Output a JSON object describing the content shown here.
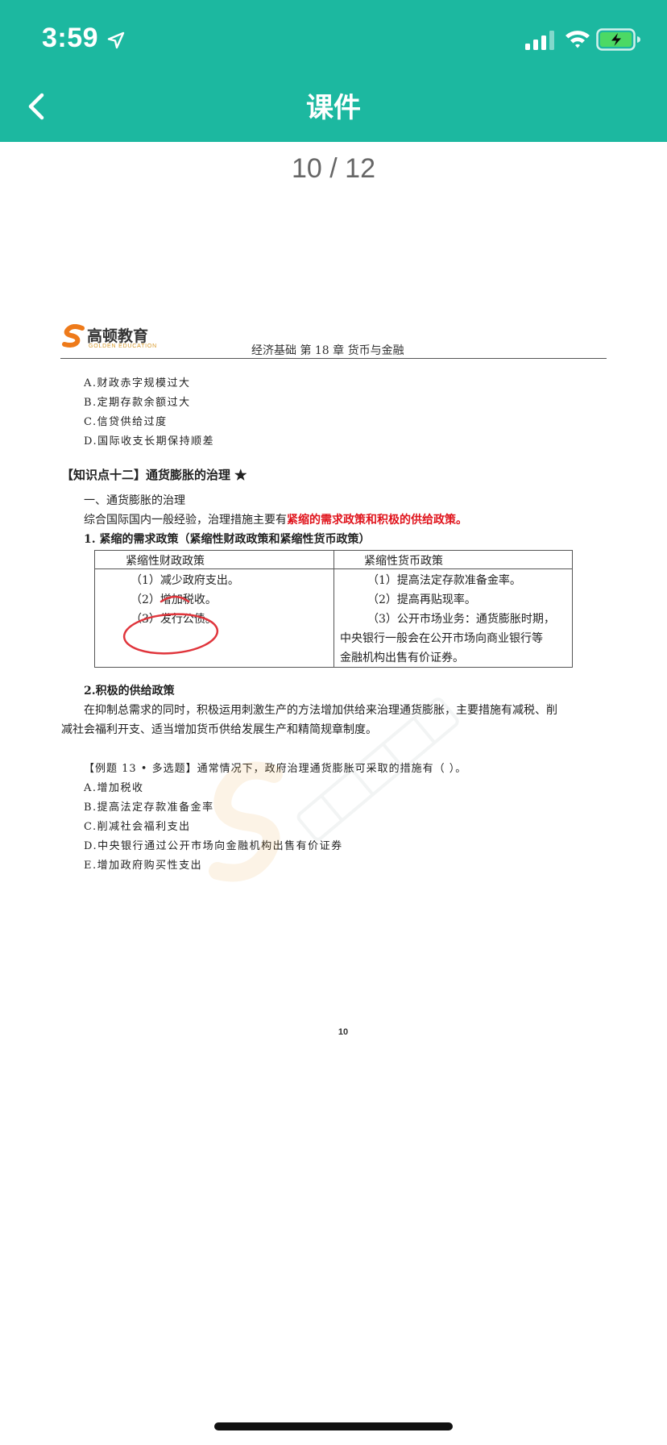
{
  "status_bar": {
    "time": "3:59",
    "icons": [
      "location-arrow-icon",
      "cellular-signal-icon",
      "wifi-icon",
      "battery-charging-icon"
    ],
    "battery_color": "#4cd964"
  },
  "nav": {
    "title": "课件",
    "back_icon": "chevron-left-icon",
    "background_color": "#1cb8a0"
  },
  "pager": {
    "current": 10,
    "total": 12,
    "text": "10 / 12"
  },
  "document": {
    "logo_text": "高顿教育",
    "logo_subtext": "GOLDEN EDUCATION",
    "header": "经济基础  第 18 章  货币与金融",
    "prev_options": [
      "A.财政赤字规模过大",
      "B.定期存款余额过大",
      "C.信贷供给过度",
      "D.国际收支长期保持顺差"
    ],
    "section_title": "【知识点十二】通货膨胀的治理 ★",
    "subheading": "一、通货膨胀的治理",
    "intro_plain": "综合国际国内一般经验，治理措施主要有",
    "intro_highlight": "紧缩的需求政策和积极的供给政策。",
    "policy1_heading": "1.   紧缩的需求政策（紧缩性财政政策和紧缩性货币政策）",
    "table": {
      "headers": [
        "紧缩性财政政策",
        "紧缩性货币政策"
      ],
      "fiscal": [
        "（1）减少政府支出。",
        "（2）增加税收。",
        "（3）发行公债。"
      ],
      "monetary": [
        "（1）提高法定存款准备金率。",
        "（2）提高再贴现率。",
        "（3）公开市场业务：通货膨胀时期，",
        "中央银行一般会在公开市场向商业银行等",
        "金融机构出售有价证券。"
      ]
    },
    "policy2_heading": "2.积极的供给政策",
    "policy2_lines": [
      "在抑制总需求的同时，积极运用刺激生产的方法增加供给来治理通货膨胀，主要措施有减税、削",
      "减社会福利开支、适当增加货币供给发展生产和精简规章制度。"
    ],
    "example_question": "【例题 13 • 多选题】通常情况下，政府治理通货膨胀可采取的措施有（ ）。",
    "example_options": [
      "A.增加税收",
      "B.提高法定存款准备金率",
      "C.削减社会福利支出",
      "D.中央银行通过公开市场向金融机构出售有价证券",
      "E.增加政府购买性支出"
    ],
    "page_number": "10",
    "highlight_color": "#e0141c",
    "annotation_color": "#e0353c"
  }
}
